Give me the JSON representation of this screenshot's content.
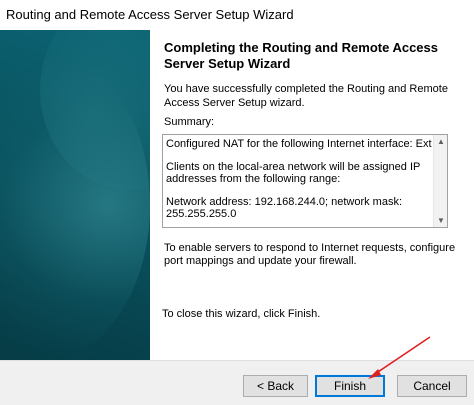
{
  "window": {
    "title": "Routing and Remote Access Server Setup Wizard"
  },
  "content": {
    "heading": "Completing the Routing and Remote Access Server Setup Wizard",
    "intro": "You have successfully completed the Routing and Remote Access Server Setup wizard.",
    "summary_label": "Summary:",
    "summary_lines": [
      "Configured NAT for the following Internet interface: Extern",
      "Clients on the local-area network will be assigned IP addresses from the following range:",
      "Network address: 192.168.244.0; network mask: 255.255.255.0"
    ],
    "enable_text": "To enable servers to respond to Internet requests, configure port mappings and update your firewall.",
    "close_text": "To close this wizard, click Finish."
  },
  "buttons": {
    "back": "< Back",
    "finish": "Finish",
    "cancel": "Cancel"
  },
  "colors": {
    "side_panel": "#0a5866",
    "annotation_arrow": "#e02020",
    "default_button_border": "#0078d7"
  }
}
